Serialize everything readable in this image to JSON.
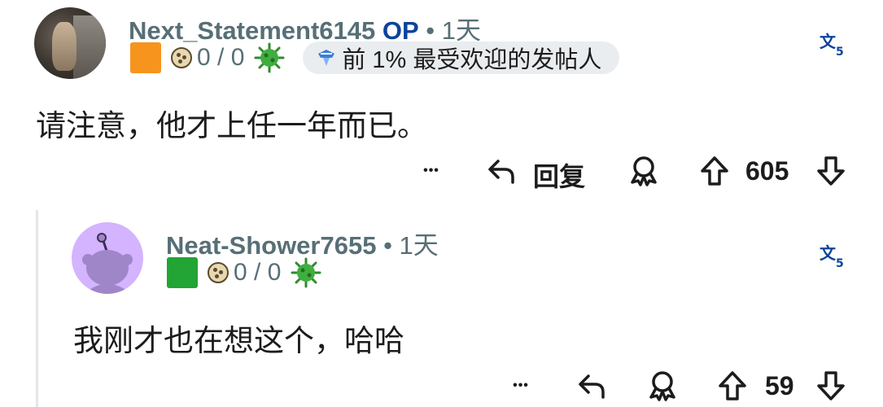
{
  "comments": [
    {
      "username": "Next_Statement6145",
      "op_label": "OP",
      "separator": " • ",
      "time": "1天",
      "flair_color": "#f7941d",
      "flair_score": "0 / 0",
      "badge_text": "前 1% 最受欢迎的发帖人",
      "body": "请注意，他才上任一年而已。",
      "more_label": "•••",
      "reply_label": "回复",
      "votes": "605"
    },
    {
      "username": "Neat-Shower7655",
      "separator": " • ",
      "time": "1天",
      "flair_color": "#22a534",
      "flair_score": "0 / 0",
      "body": "我刚才也在想这个，哈哈",
      "more_label": "•••",
      "votes": "59"
    }
  ],
  "icons": {
    "translate": "translate-icon",
    "reply": "reply-arrow-icon",
    "award": "award-icon",
    "upvote": "upvote-arrow-icon",
    "downvote": "downvote-arrow-icon",
    "coin": "coin-icon",
    "virus": "virus-icon",
    "badge": "top-poster-icon"
  }
}
